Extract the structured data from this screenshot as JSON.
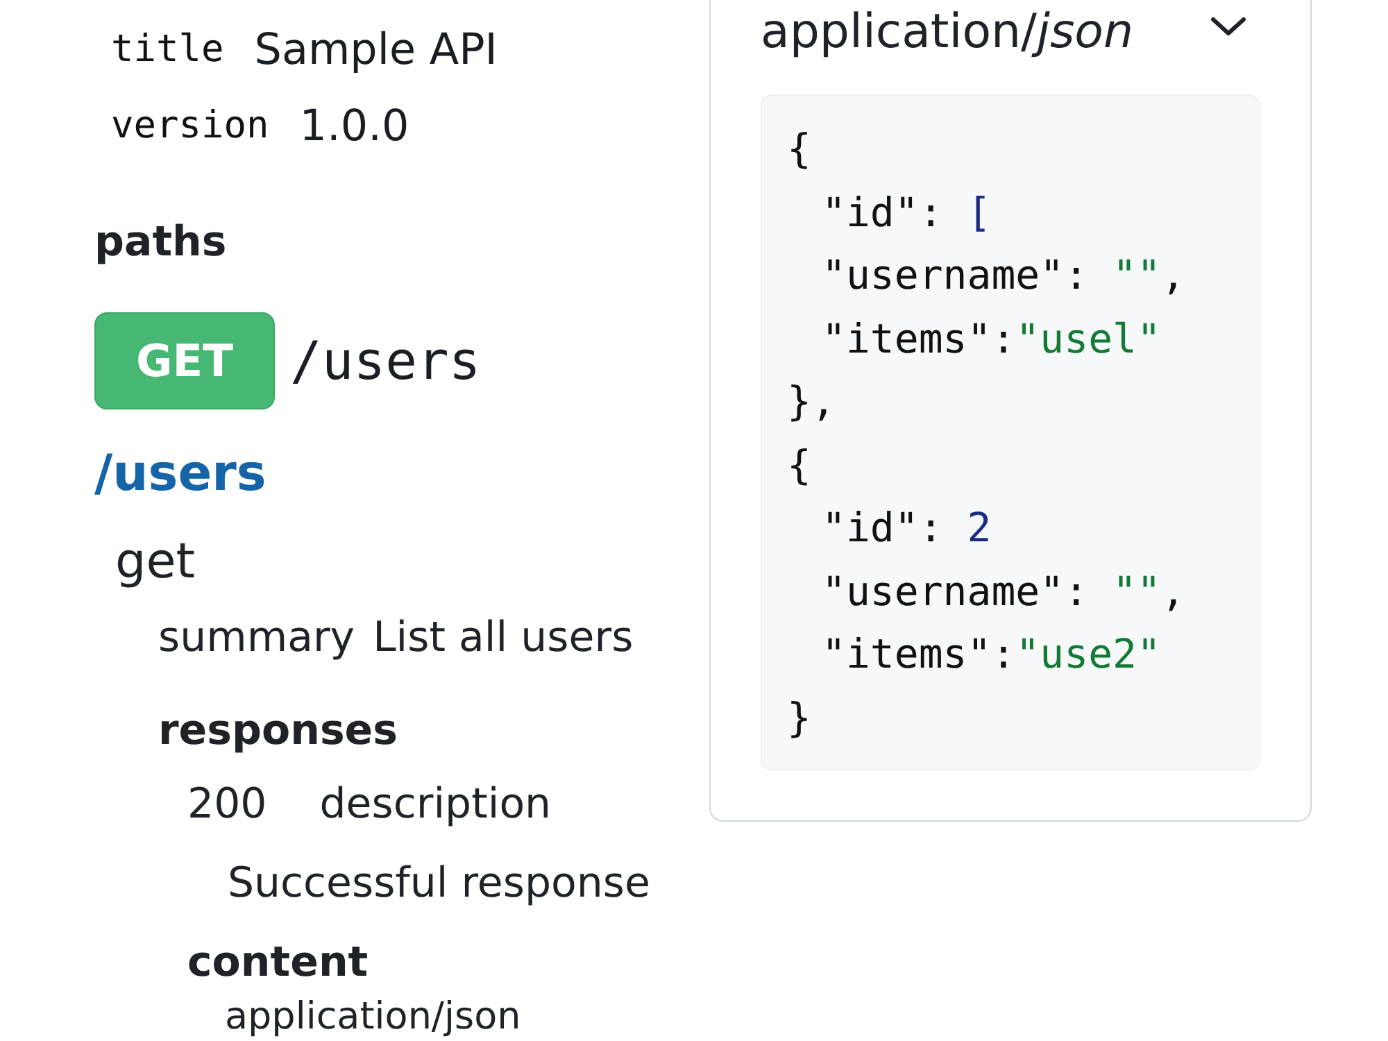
{
  "info": [
    {
      "key": "title",
      "value": "Sample API"
    },
    {
      "key": "version",
      "value": "1.0.0"
    }
  ],
  "paths": {
    "heading": "paths",
    "endpoint": {
      "method": "GET",
      "path": "/users"
    },
    "items": [
      {
        "path": "/users",
        "operations": [
          {
            "method": "get",
            "summary_label": "summary",
            "summary": "List all users",
            "responses_heading": "responses",
            "responses": [
              {
                "code": "200",
                "label": "description",
                "description": "Successful response",
                "content_heading": "content",
                "media_type": "application/json"
              }
            ]
          }
        ]
      }
    ]
  },
  "example_panel": {
    "media_type": "application/*json*",
    "lines": [
      {
        "tokens": [
          {
            "kind": "plain",
            "text": "{"
          }
        ],
        "children": [
          {
            "tokens": [
              {
                "kind": "plain",
                "text": "\"id\": "
              },
              {
                "kind": "number",
                "text": "["
              }
            ]
          },
          {
            "tokens": [
              {
                "kind": "plain",
                "text": "\"username\": "
              },
              {
                "kind": "string",
                "text": "\"\""
              },
              {
                "kind": "plain",
                "text": ","
              }
            ]
          },
          {
            "tokens": [
              {
                "kind": "plain",
                "text": "\"items\":"
              },
              {
                "kind": "string",
                "text": "\"usel\""
              }
            ]
          }
        ]
      },
      {
        "tokens": [
          {
            "kind": "plain",
            "text": "},"
          }
        ]
      },
      {
        "tokens": [
          {
            "kind": "plain",
            "text": "{"
          }
        ],
        "children": [
          {
            "tokens": [
              {
                "kind": "plain",
                "text": "\"id\": "
              },
              {
                "kind": "number",
                "text": "2"
              }
            ]
          },
          {
            "tokens": [
              {
                "kind": "plain",
                "text": "\"username\": "
              },
              {
                "kind": "string",
                "text": "\"\""
              },
              {
                "kind": "plain",
                "text": ","
              }
            ]
          },
          {
            "tokens": [
              {
                "kind": "plain",
                "text": "\"items\":"
              },
              {
                "kind": "string",
                "text": "\"use2\""
              }
            ]
          }
        ]
      },
      {
        "tokens": [
          {
            "kind": "plain",
            "text": "}"
          }
        ]
      }
    ]
  }
}
